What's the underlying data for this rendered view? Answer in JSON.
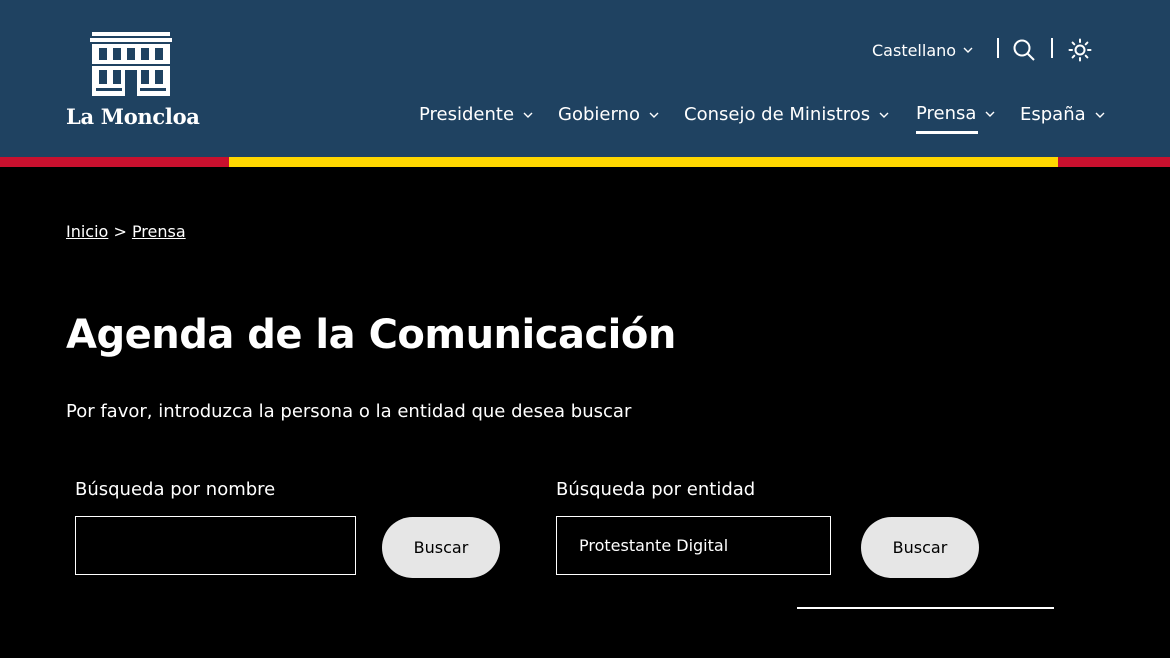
{
  "header": {
    "logo_text": "La Moncloa",
    "language": "Castellano",
    "search_icon": "search-icon",
    "theme_icon": "sun-icon"
  },
  "nav": {
    "items": [
      {
        "label": "Presidente"
      },
      {
        "label": "Gobierno"
      },
      {
        "label": "Consejo de Ministros"
      },
      {
        "label": "Prensa",
        "active": true
      },
      {
        "label": "España"
      }
    ]
  },
  "colors": {
    "header_bg": "#1f4261",
    "stripe_red": "#c8102e",
    "stripe_yellow": "#ffd700",
    "page_bg": "#000000",
    "button_bg": "#e6e6e6"
  },
  "breadcrumb": {
    "items": [
      "Inicio",
      "Prensa"
    ],
    "separator": ">"
  },
  "main": {
    "title": "Agenda de la Comunicación",
    "intro": "Por favor, introduzca la persona o la entidad que desea buscar",
    "name_search": {
      "label": "Búsqueda por nombre",
      "value": "",
      "button": "Buscar"
    },
    "entity_search": {
      "label": "Búsqueda por entidad",
      "value": "Protestante Digital",
      "button": "Buscar"
    }
  }
}
